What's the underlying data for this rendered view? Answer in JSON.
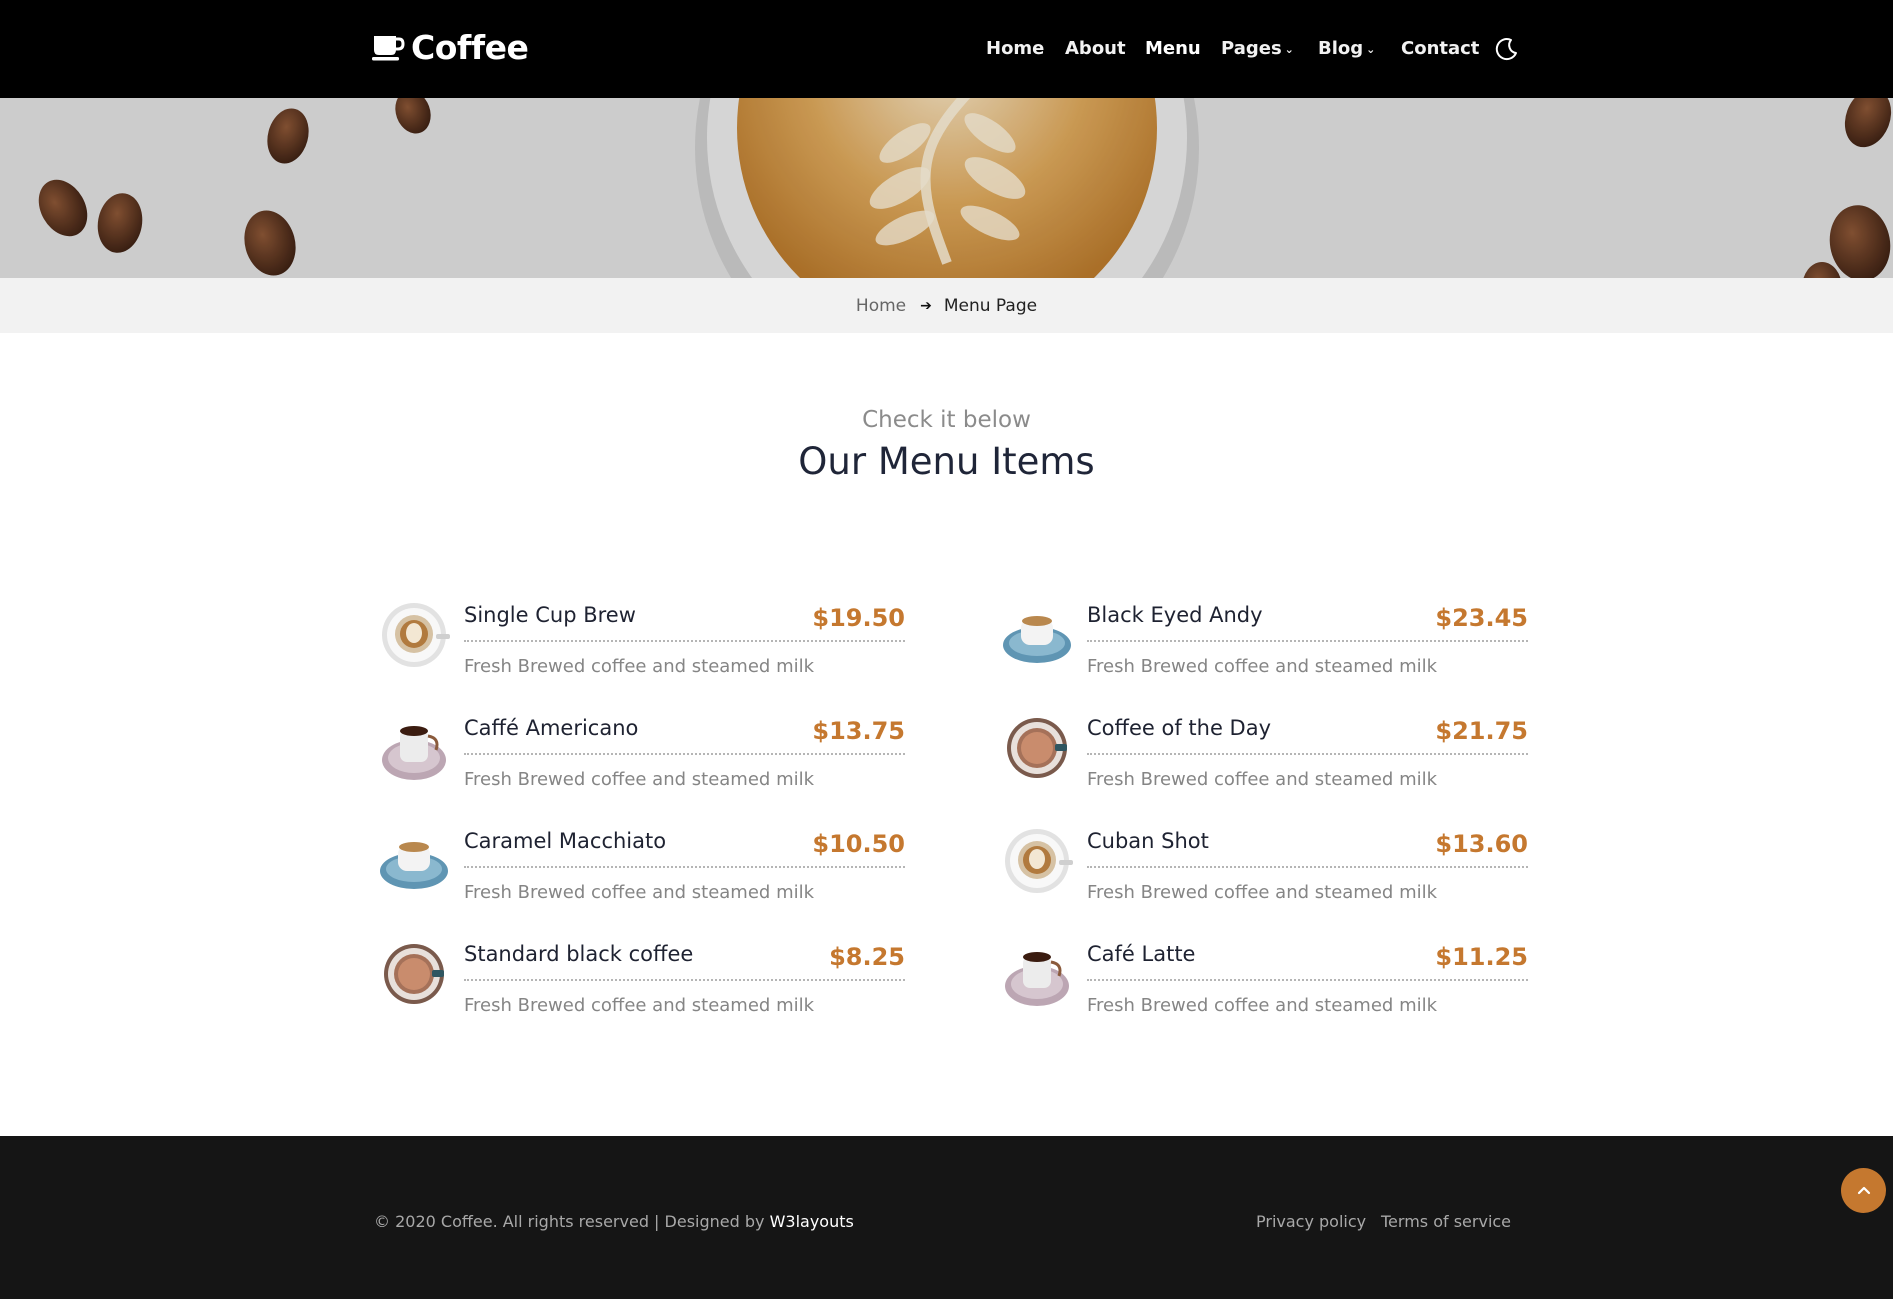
{
  "header": {
    "logo_text": "Coffee",
    "nav": [
      {
        "label": "Home"
      },
      {
        "label": "About"
      },
      {
        "label": "Menu",
        "active": true
      },
      {
        "label": "Pages",
        "dropdown": true
      },
      {
        "label": "Blog",
        "dropdown": true
      },
      {
        "label": "Contact"
      }
    ],
    "theme_toggle_icon": "moon-icon"
  },
  "breadcrumb": {
    "home": "Home",
    "separator_icon": "arrow-right-icon",
    "current": "Menu Page"
  },
  "section": {
    "subtitle": "Check it below",
    "title": "Our Menu Items"
  },
  "menu": {
    "left": [
      {
        "name": "Single Cup Brew",
        "price": "$19.50",
        "description": "Fresh Brewed coffee and steamed milk",
        "cup": "latte-art-cup"
      },
      {
        "name": "Caffé Americano",
        "price": "$13.75",
        "description": "Fresh Brewed coffee and steamed milk",
        "cup": "espresso-cup-lavender"
      },
      {
        "name": "Caramel Macchiato",
        "price": "$10.50",
        "description": "Fresh Brewed coffee and steamed milk",
        "cup": "blue-saucer-cup"
      },
      {
        "name": "Standard black coffee",
        "price": "$8.25",
        "description": "Fresh Brewed coffee and steamed milk",
        "cup": "top-view-black-cup"
      }
    ],
    "right": [
      {
        "name": "Black Eyed Andy",
        "price": "$23.45",
        "description": "Fresh Brewed coffee and steamed milk",
        "cup": "blue-saucer-cup"
      },
      {
        "name": "Coffee of the Day",
        "price": "$21.75",
        "description": "Fresh Brewed coffee and steamed milk",
        "cup": "top-view-black-cup"
      },
      {
        "name": "Cuban Shot",
        "price": "$13.60",
        "description": "Fresh Brewed coffee and steamed milk",
        "cup": "latte-art-cup"
      },
      {
        "name": "Café Latte",
        "price": "$11.25",
        "description": "Fresh Brewed coffee and steamed milk",
        "cup": "espresso-cup-lavender"
      }
    ]
  },
  "footer": {
    "copyright": "© 2020 Coffee. All rights reserved | Designed by ",
    "designer": "W3layouts",
    "links": [
      "Privacy policy",
      "Terms of service"
    ],
    "back_to_top_icon": "chevron-up-icon"
  },
  "colors": {
    "accent": "#c5782f",
    "header_bg": "#000000",
    "footer_bg": "#151515",
    "breadcrumb_bg": "#f2f2f2",
    "title": "#1f2538"
  }
}
